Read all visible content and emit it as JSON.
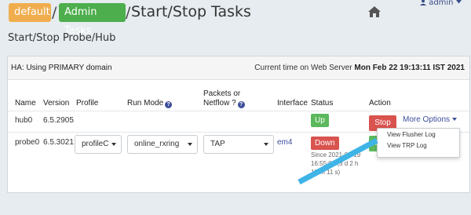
{
  "breadcrumb": {
    "home": "default",
    "section": "Admin Tasks",
    "separator": "/",
    "current": "Start/Stop Tasks"
  },
  "user_menu": {
    "label": "admin"
  },
  "page": {
    "title": "Start/Stop Probe/Hub"
  },
  "panel": {
    "title": "HA: Using PRIMARY domain",
    "clock_label": "Current time on Web Server",
    "clock_value": "Mon Feb 22 19:13:11 IST 2021"
  },
  "table": {
    "headers": {
      "name": "Name",
      "version": "Version",
      "profile": "Profile",
      "run_mode": "Run Mode",
      "packets_line1": "Packets or",
      "packets_line2": "Netflow ?",
      "interface": "Interface",
      "status": "Status",
      "action": "Action"
    },
    "rows": [
      {
        "name": "hub0",
        "version": "6.5.2905",
        "status": "Up",
        "action": "Stop",
        "more": "More Options"
      },
      {
        "name": "probe0",
        "version": "6.5.3021",
        "profile": "profileC",
        "run_mode": "online_rxring",
        "packets": "TAP",
        "interface": "em4",
        "status": "Down",
        "since": [
          "Since 2021-02-19",
          "16:55:01 (3 d 2 h",
          "18 m 11 s)"
        ],
        "action": "Start"
      }
    ]
  },
  "dropdown": {
    "items": [
      "View Flusher Log",
      "View TRP Log"
    ]
  },
  "colors": {
    "accent": "#3b4d9a",
    "up": "#5cb85c",
    "down": "#d9534f",
    "warning": "#f0ad4e",
    "annotation": "#3fb4e6"
  }
}
